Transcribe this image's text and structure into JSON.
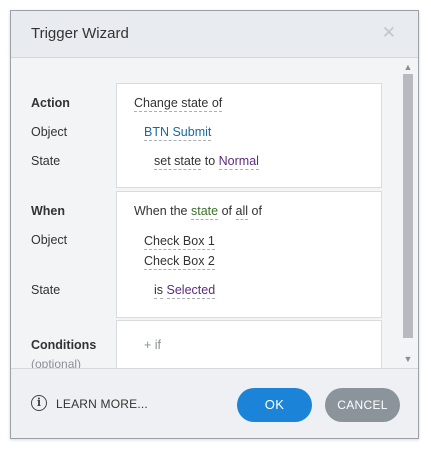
{
  "dialog": {
    "title": "Trigger Wizard",
    "close_icon": "close-icon",
    "close_symbol": "✕"
  },
  "action": {
    "heading": "Action",
    "text": "Change state of",
    "object_label": "Object",
    "object_value": "BTN Submit",
    "state_label": "State",
    "state_prefix": "set state",
    "state_to": "to",
    "state_value": "Normal"
  },
  "when": {
    "heading": "When",
    "text_prefix": "When the",
    "text_state": "state",
    "text_of": "of",
    "text_all": "all",
    "text_of2": "of",
    "object_label": "Object",
    "objects": [
      "Check Box 1",
      "Check Box 2"
    ],
    "state_label": "State",
    "state_is": "is",
    "state_value": "Selected"
  },
  "conditions": {
    "heading": "Conditions",
    "subheading": "(optional)",
    "add_if": "+ if"
  },
  "scrollbar": {
    "up_symbol": "▲",
    "down_symbol": "▼"
  },
  "footer": {
    "info_symbol": "i",
    "learn_more": "LEARN MORE...",
    "ok": "OK",
    "cancel": "CANCEL"
  },
  "colors": {
    "ok_button": "#1b84d8",
    "cancel_button": "#8b939b",
    "link_blue": "#1a6aa0",
    "value_purple": "#5d2b7d",
    "state_green": "#3b6f2c"
  }
}
